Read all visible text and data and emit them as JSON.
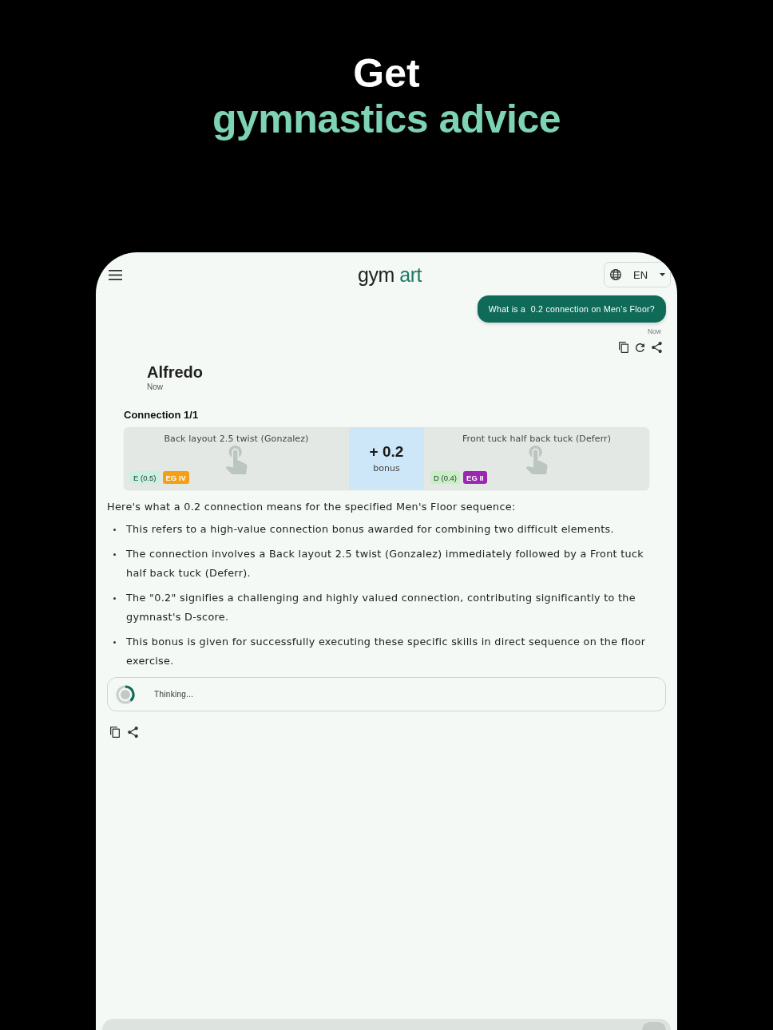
{
  "headline": {
    "line_1": "Get",
    "line_2": "gymnastics advice"
  },
  "app_bar": {
    "logo": {
      "part_1": "gym",
      "part_2": "art"
    },
    "language": "EN"
  },
  "user_message": {
    "text": "What is a  0.2 connection on Men’s Floor?",
    "time": "Now"
  },
  "assistant": {
    "name": "Alfredo",
    "time": "Now"
  },
  "connection": {
    "title": "Connection 1/1",
    "elements": [
      {
        "name": "Back layout 2.5 twist (Gonzalez)",
        "badges": [
          {
            "kind": "value",
            "text": "E (0.5)",
            "color": "#c8f1e4"
          },
          {
            "kind": "group",
            "text": "EG IV",
            "color": "#f59f17"
          }
        ]
      },
      {
        "name": "Front tuck half back tuck (Deferr)",
        "badges": [
          {
            "kind": "value",
            "text": "D (0.4)",
            "color": "#c9efc4"
          },
          {
            "kind": "group",
            "text": "EG II",
            "color": "#9c27b0"
          }
        ]
      }
    ],
    "bonus": {
      "amount": "+ 0.2",
      "label": "bonus"
    }
  },
  "answer": {
    "intro": "Here's what a 0.2 connection means for the specified Men's Floor sequence:",
    "bullets": [
      "This refers to a high-value connection bonus awarded for combining two difficult elements.",
      "The connection involves a Back layout 2.5 twist (Gonzalez) immediately followed by a Front tuck half back tuck (Deferr).",
      "The \"0.2\" signifies a challenging and highly valued connection, contributing significantly to the gymnast's D-score.",
      "This bonus is given for successfully executing these specific skills in direct sequence on the floor exercise."
    ]
  },
  "thinking": {
    "text": "Thinking..."
  }
}
